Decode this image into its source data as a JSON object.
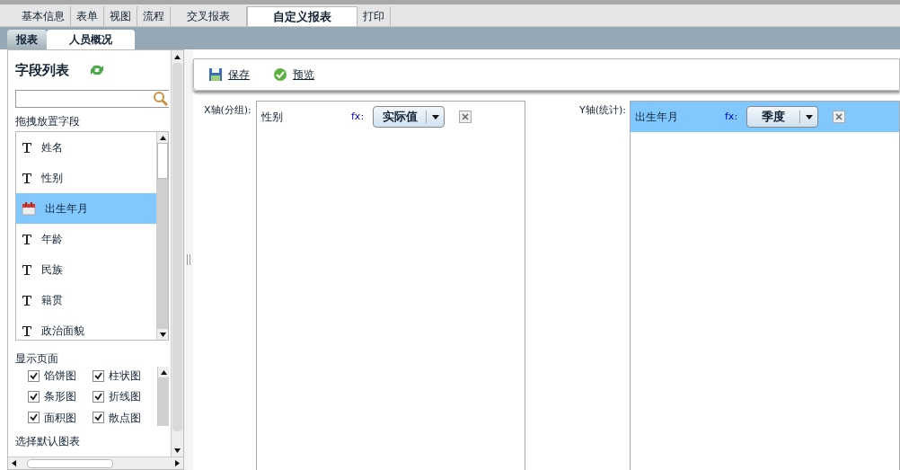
{
  "top_tabs": [
    {
      "label": "基本信息",
      "selected": false
    },
    {
      "label": "表单",
      "selected": false
    },
    {
      "label": "视图",
      "selected": false
    },
    {
      "label": "流程",
      "selected": false
    },
    {
      "label": "交叉报表",
      "selected": false
    },
    {
      "label": "自定义报表",
      "selected": true
    },
    {
      "label": "打印",
      "selected": false
    }
  ],
  "sub_tabs": [
    {
      "label": "报表",
      "selected": false
    },
    {
      "label": "人员概况",
      "selected": true
    }
  ],
  "field_panel": {
    "title": "字段列表",
    "drag_label": "拖拽放置字段",
    "fields": [
      {
        "name": "姓名",
        "kind": "text",
        "selected": false
      },
      {
        "name": "性别",
        "kind": "text",
        "selected": false
      },
      {
        "name": "出生年月",
        "kind": "date",
        "selected": true
      },
      {
        "name": "年龄",
        "kind": "text",
        "selected": false
      },
      {
        "name": "民族",
        "kind": "text",
        "selected": false
      },
      {
        "name": "籍贯",
        "kind": "text",
        "selected": false
      },
      {
        "name": "政治面貌",
        "kind": "text",
        "selected": false
      }
    ],
    "display_label": "显示页面",
    "chart_types": [
      {
        "label": "馅饼图",
        "checked": true
      },
      {
        "label": "柱状图",
        "checked": true
      },
      {
        "label": "条形图",
        "checked": true
      },
      {
        "label": "折线图",
        "checked": true
      },
      {
        "label": "面积图",
        "checked": true
      },
      {
        "label": "散点图",
        "checked": true
      }
    ],
    "default_chart_label": "选择默认图表"
  },
  "toolbar": [
    {
      "label": "保存",
      "kind": "save"
    },
    {
      "label": "预览",
      "kind": "preview"
    }
  ],
  "x_axis": {
    "label": "X轴(分组):",
    "items": [
      {
        "name": "性别",
        "fx": "fx:",
        "function": "实际值",
        "selected": false
      }
    ]
  },
  "y_axis": {
    "label": "Y轴(统计):",
    "items": [
      {
        "name": "出生年月",
        "fx": "fx:",
        "function": "季度",
        "selected": true
      }
    ]
  }
}
